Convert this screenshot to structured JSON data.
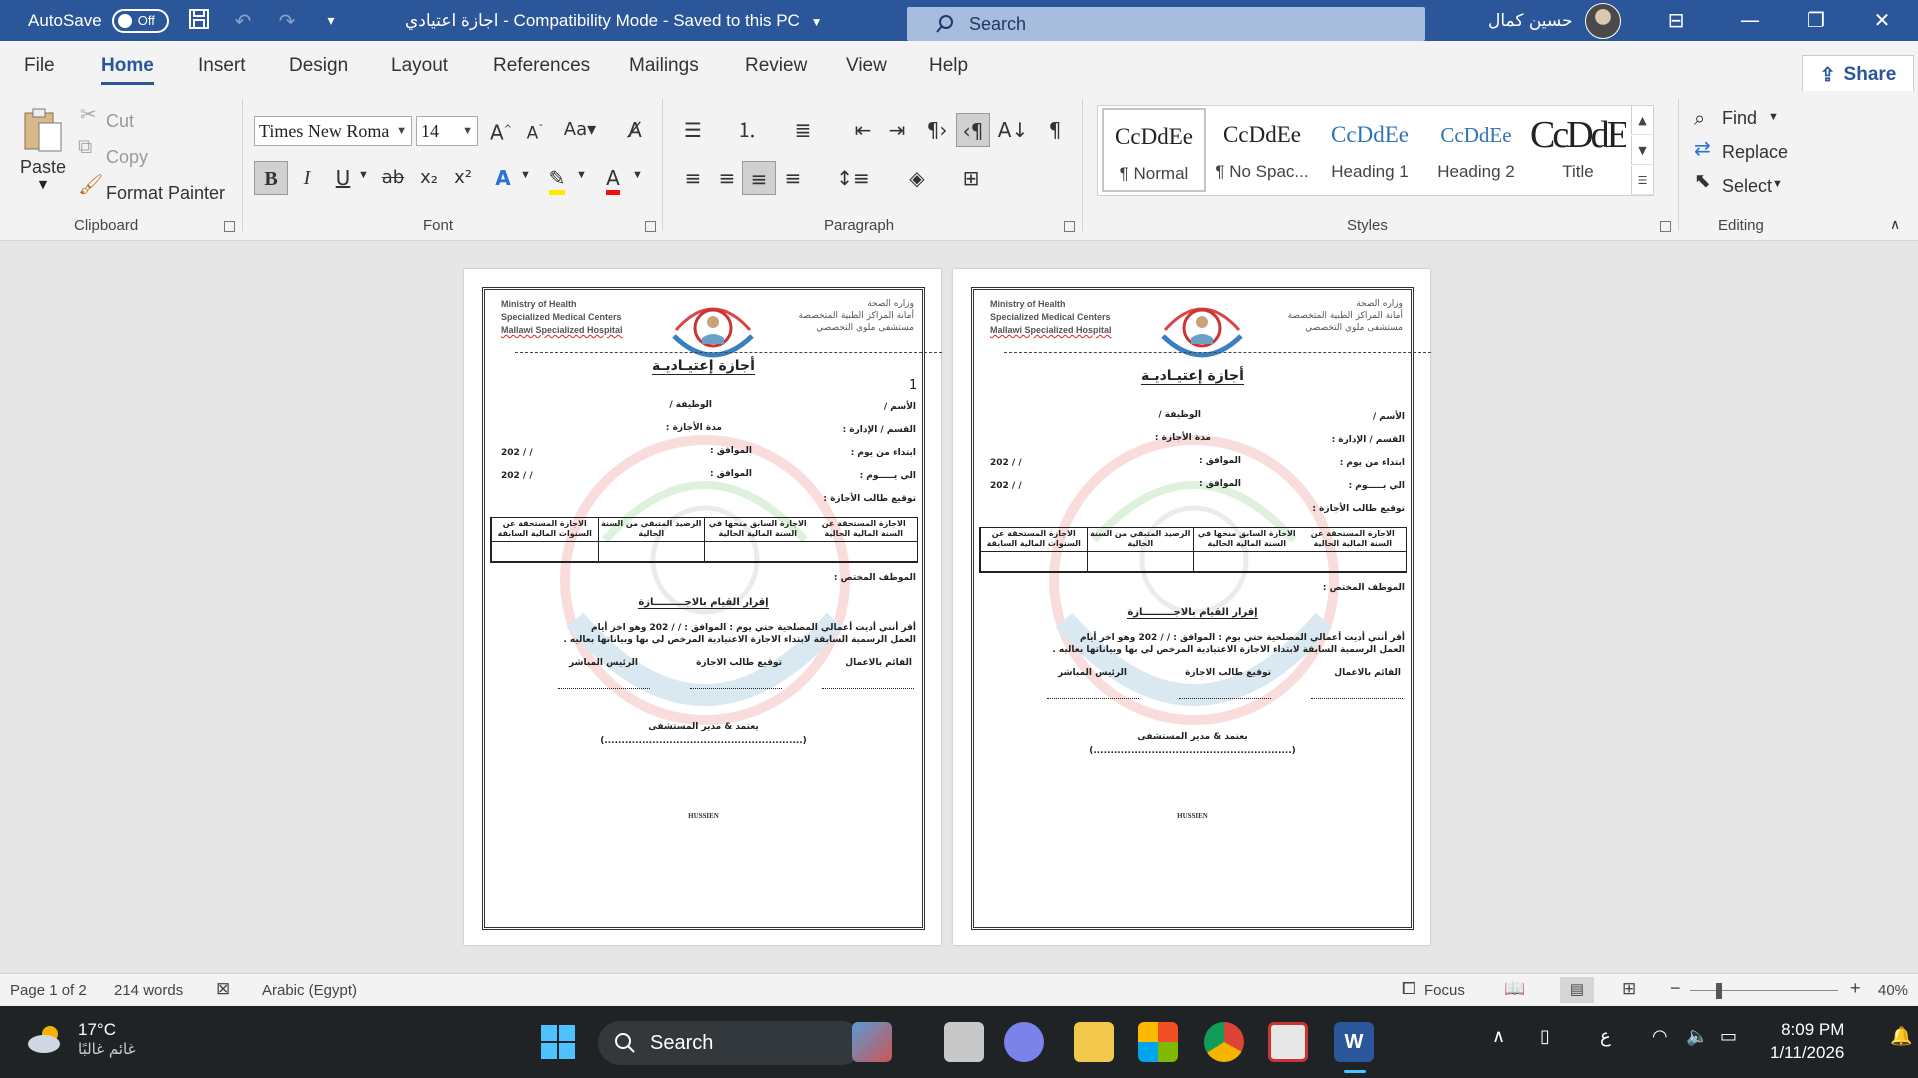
{
  "titlebar": {
    "autosave_label": "AutoSave",
    "autosave_state": "Off",
    "doc_title": "اجازة اعتيادي  -  Compatibility Mode  -  Saved to this PC",
    "search_placeholder": "Search",
    "user_name": "حسين كمال",
    "accent": "#2b579a"
  },
  "menu": {
    "tabs": [
      "File",
      "Home",
      "Insert",
      "Design",
      "Layout",
      "References",
      "Mailings",
      "Review",
      "View",
      "Help"
    ],
    "active": "Home",
    "share_label": "Share"
  },
  "ribbon": {
    "clipboard": {
      "label": "Clipboard",
      "paste": "Paste",
      "cut": "Cut",
      "copy": "Copy",
      "format_painter": "Format Painter"
    },
    "font": {
      "label": "Font",
      "font_name": "Times New Roma",
      "font_size": "14"
    },
    "paragraph": {
      "label": "Paragraph"
    },
    "styles": {
      "label": "Styles",
      "items": [
        {
          "sample": "CcDdEe",
          "name": "¶ Normal"
        },
        {
          "sample": "CcDdEe",
          "name": "¶ No Spac..."
        },
        {
          "sample": "CcDdEe",
          "name": "Heading 1"
        },
        {
          "sample": "CcDdEe",
          "name": "Heading 2"
        },
        {
          "sample": "CcDdEe",
          "name": "Title"
        }
      ]
    },
    "editing": {
      "label": "Editing",
      "find": "Find",
      "replace": "Replace",
      "select": "Select"
    }
  },
  "document": {
    "header_en": [
      "Ministry of Health",
      "Specialized Medical Centers",
      "Mallawi  Specialized  Hospital"
    ],
    "header_ar": [
      "وزاره الصحة",
      "أمانة المراكز الطبية المتخصصة",
      "مستشفى ملوي التخصصي"
    ],
    "title": "أجازة إعتيـاديـة",
    "fields": {
      "name": "الأسم /",
      "job": "الوظيفة /",
      "dept": "القسم  /  الإدارة :",
      "duration": "مدة الأجازة :",
      "from_day": "ابتداء من يوم :",
      "to_day": "الي يـــــوم :",
      "date_label": "الموافق :",
      "date_value": "202        /         /",
      "signature": "توقيع طالب الأجازة :"
    },
    "table_headers": [
      "الاجازة المستحقة عن السنة المالية الحالية",
      "الاجازة السابق منحها في السنة المالية الحالية",
      "الرصيد المتبقي من السنة الحالية",
      "الاجازة المستحقة عن السنوات المالية السابقة"
    ],
    "employee": "الموظف المختص :",
    "resume_title": "إقرار القيام بالاجـــــــــازة",
    "resume_text_1": "أقر أنني أديت أعمالي المصلحية حتي يوم :           الموافق :    /    /    202  وهو اخر أيام",
    "resume_text_2": "العمل الرسمية السابقة لابتداء الاجازة الاعتيادية المرخص لي بها وبياناتها بعاليه .",
    "roles": [
      "القائم بالاعمال",
      "توقيع طالب الاجازة",
      "الرئيس المباشر"
    ],
    "approve": "يعتمد  &  مدير المستشفى",
    "approve_dots": "(..........................................................)",
    "footer": "HUSSIEN",
    "page1_marker": "1"
  },
  "status": {
    "page": "Page 1 of 2",
    "words": "214 words",
    "language": "Arabic (Egypt)",
    "focus": "Focus",
    "zoom": "40%"
  },
  "taskbar": {
    "temp": "17°C",
    "weather": "غائم غالبًا",
    "search": "Search",
    "lang": "ع",
    "time": "8:09 PM",
    "date": "1/11/2026"
  }
}
